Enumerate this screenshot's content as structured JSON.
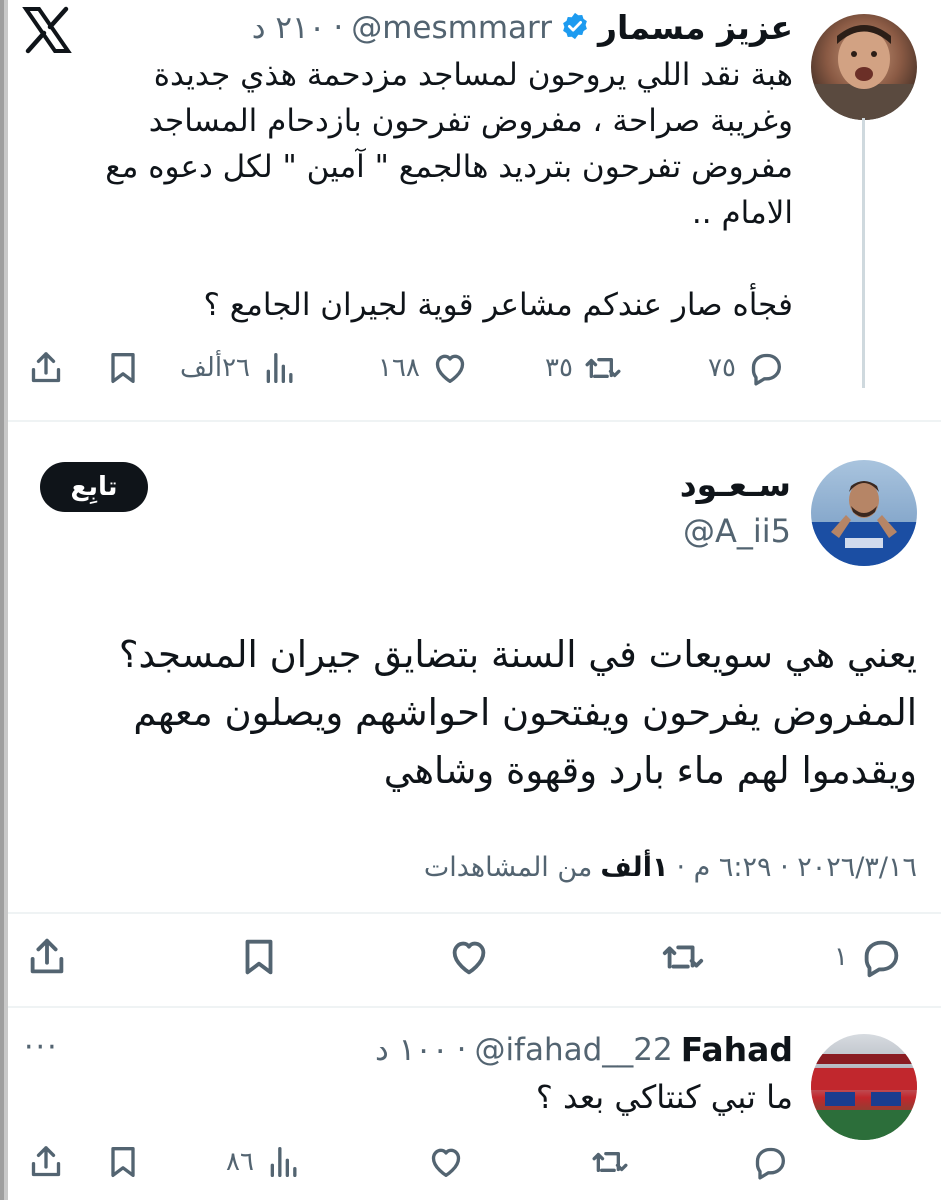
{
  "x_logo": "𝕏",
  "tweet1": {
    "name": "عزيز مسمار",
    "handle": "@mesmmarr",
    "time": "٢١٠ د",
    "body": "هبة نقد اللي يروحون لمساجد مزدحمة هذي جديدة\nوغريبة صراحة ، مفروض تفرحون بازدحام المساجد\nمفروض تفرحون بترديد  هالجمع \" آمين \" لكل دعوه مع\nالامام ..\n\nفجأه صار عندكم مشاعر قوية لجيران الجامع ؟",
    "replies": "٧٥",
    "retweets": "٣٥",
    "likes": "١٦٨",
    "views": "٢٦ألف"
  },
  "tweet2": {
    "name": "سـعـود",
    "handle": "@A_ii5",
    "follow_label": "تابِع",
    "body": "يعني هي سويعات في السنة بتضايق جيران المسجد؟\nالمفروض يفرحون ويفتحون احواشهم ويصلون معهم\nويقدموا لهم ماء بارد وقهوة وشاهي",
    "meta_date": "٢٠٢٦/٣/١٦ · ٦:٢٩ م ·",
    "meta_views_count": "١ألف",
    "meta_views_label": "من المشاهدات",
    "replies": "١"
  },
  "tweet3": {
    "name": "Fahad",
    "handle": "@ifahad__22",
    "time": "١٠٠ د",
    "more": "···",
    "body": "ما تبي كنتاكي بعد ؟",
    "views": "٨٦"
  },
  "colors": {
    "verified": "#1d9bf0",
    "muted": "#536471",
    "text": "#0f1419"
  }
}
